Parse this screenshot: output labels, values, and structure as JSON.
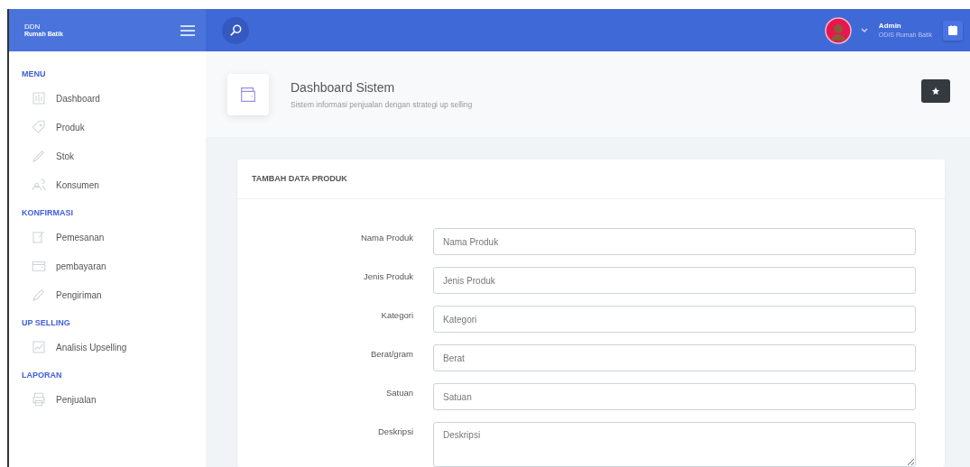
{
  "brand": {
    "line_1": "DDN",
    "line_2": "Rumah Batik"
  },
  "user": {
    "name": "Admin",
    "subtitle": "ODIS Rumah Batik"
  },
  "sidebar": {
    "sections": [
      {
        "heading": "MENU",
        "items": [
          {
            "label": "Dashboard"
          },
          {
            "label": "Produk"
          },
          {
            "label": "Stok"
          },
          {
            "label": "Konsumen"
          }
        ]
      },
      {
        "heading": "KONFIRMASI",
        "items": [
          {
            "label": "Pemesanan"
          },
          {
            "label": "pembayaran"
          },
          {
            "label": "Pengiriman"
          }
        ]
      },
      {
        "heading": "UP SELLING",
        "items": [
          {
            "label": "Analisis Upselling"
          }
        ]
      },
      {
        "heading": "LAPORAN",
        "items": [
          {
            "label": "Penjualan"
          }
        ]
      }
    ]
  },
  "page_header": {
    "title": "Dashboard Sistem",
    "subtitle": "Sistem informasi penjualan dengan strategi up selling"
  },
  "form": {
    "title": "TAMBAH DATA PRODUK",
    "fields": [
      {
        "label": "Nama Produk",
        "placeholder": "Nama Produk",
        "kind": "input"
      },
      {
        "label": "Jenis Produk",
        "placeholder": "Jenis Produk",
        "kind": "input"
      },
      {
        "label": "Kategori",
        "placeholder": "Kategori",
        "kind": "input"
      },
      {
        "label": "Berat/gram",
        "placeholder": "Berat",
        "kind": "input"
      },
      {
        "label": "Satuan",
        "placeholder": "Satuan",
        "kind": "input"
      },
      {
        "label": "Deskripsi",
        "placeholder": "Deskripsi",
        "kind": "textarea"
      }
    ]
  }
}
